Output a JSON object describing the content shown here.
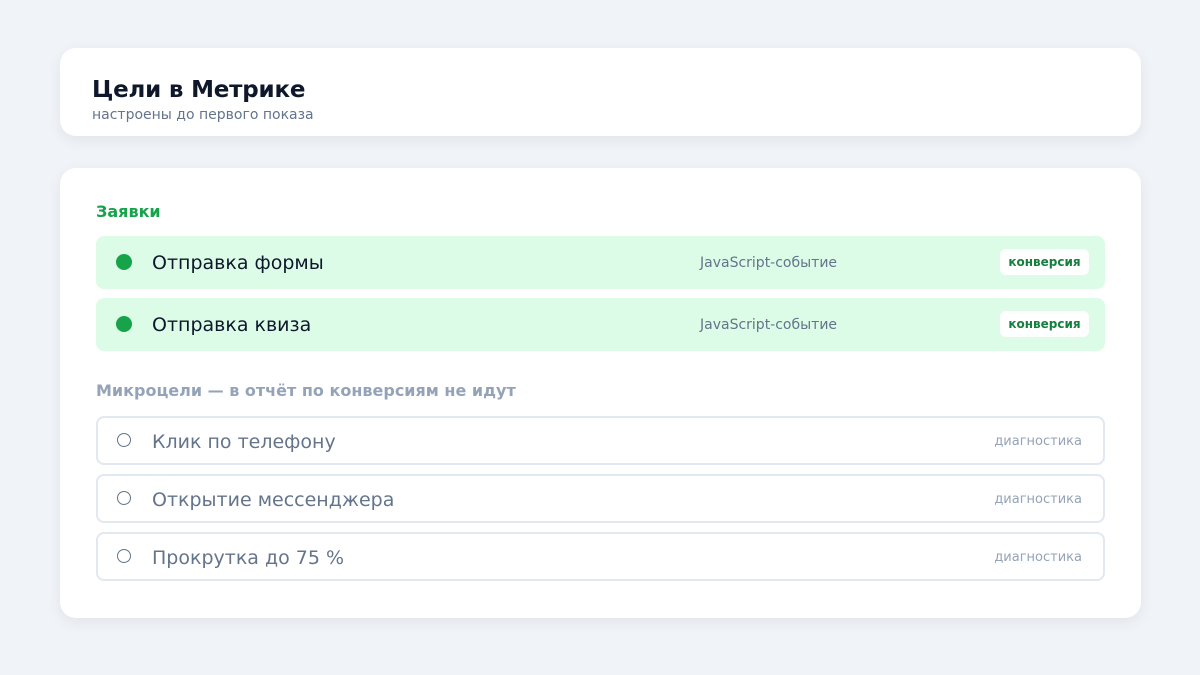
{
  "header": {
    "title": "Цели в Метрике",
    "subtitle": "настроены до первого показа"
  },
  "goals": {
    "heading": "Заявки",
    "items": [
      {
        "name": "Отправка формы",
        "type": "JavaScript-событие",
        "badge": "конверсия"
      },
      {
        "name": "Отправка квиза",
        "type": "JavaScript-событие",
        "badge": "конверсия"
      }
    ]
  },
  "micro": {
    "heading": "Микроцели — в отчёт по конверсиям не идут",
    "items": [
      {
        "name": "Клик по телефону",
        "tag": "диагностика"
      },
      {
        "name": "Открытие мессенджера",
        "tag": "диагностика"
      },
      {
        "name": "Прокрутка до 75 %",
        "tag": "диагностика"
      }
    ]
  },
  "colors": {
    "accent": "#16a34a",
    "goal_row_bg": "#dcfce7",
    "muted": "#94a3b8",
    "page_bg": "#f0f3f7"
  },
  "icons": {
    "goal": "filled-dot-icon",
    "micro": "empty-circle-icon"
  }
}
